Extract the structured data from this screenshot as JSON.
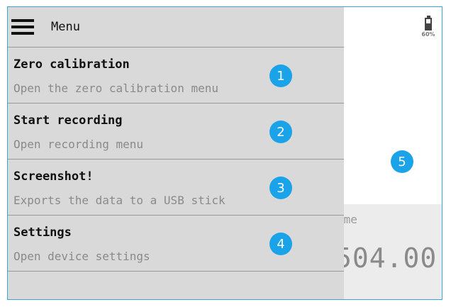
{
  "menu": {
    "title": "Menu",
    "items": [
      {
        "title": "Zero calibration",
        "description": "Open the zero calibration menu",
        "badge": "1"
      },
      {
        "title": "Start recording",
        "description": "Open recording menu",
        "badge": "2"
      },
      {
        "title": "Screenshot!",
        "description": "Exports the data to a USB stick",
        "badge": "3"
      },
      {
        "title": "Settings",
        "description": "Open device settings",
        "badge": "4"
      }
    ]
  },
  "background": {
    "badge": "5",
    "label_fragment": "ıme",
    "value_fragment": "504.00"
  },
  "status": {
    "battery_percent": "60%",
    "battery_level": 0.6
  },
  "colors": {
    "accent": "#1aa3e8",
    "frame_border": "#3aa6d6",
    "menu_bg": "#d9d9d9"
  }
}
